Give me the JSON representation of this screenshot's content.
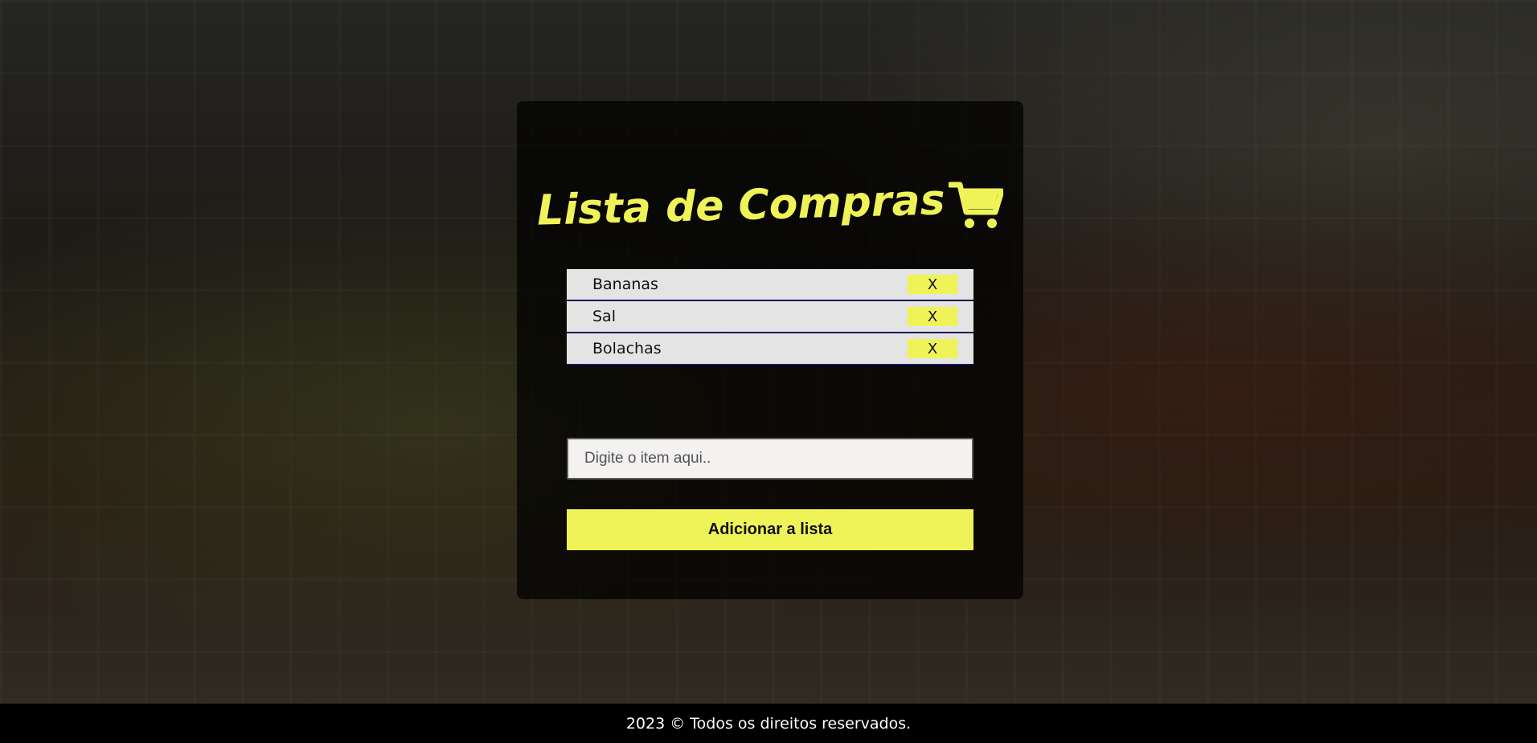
{
  "app": {
    "title": "Lista de Compras",
    "title_icon": "shopping-cart-icon",
    "accent_color": "#eff357"
  },
  "list": {
    "items": [
      {
        "label": "Bananas",
        "remove_label": "X"
      },
      {
        "label": "Sal",
        "remove_label": "X"
      },
      {
        "label": "Bolachas",
        "remove_label": "X"
      }
    ]
  },
  "form": {
    "input_value": "",
    "input_placeholder": "Digite o item aqui..",
    "add_button_label": "Adicionar a lista"
  },
  "footer": {
    "text": "2023 © Todos os direitos reservados."
  }
}
